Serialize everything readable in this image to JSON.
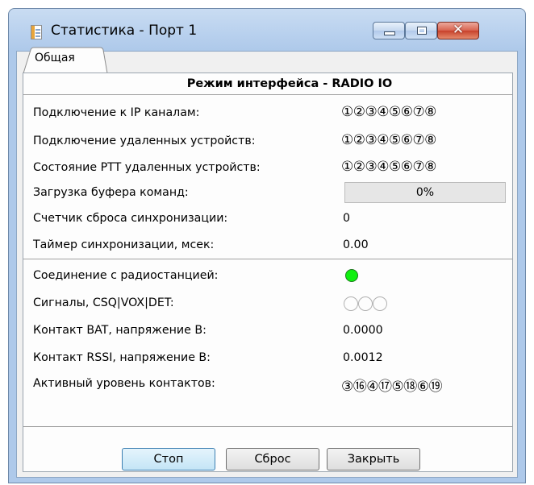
{
  "window": {
    "title": "Статистика - Порт 1",
    "controls": {
      "minimize_icon": "minimize-icon",
      "maximize_icon": "maximize-icon",
      "close_glyph": "✕"
    }
  },
  "tabs": [
    {
      "label": "Общая",
      "active": true
    }
  ],
  "section_header": "Режим интерфейса - RADIO IO",
  "rows": [
    {
      "label": "Подключение к IP каналам:",
      "value": "①②③④⑤⑥⑦⑧"
    },
    {
      "label": "Подключение удаленных устройств:",
      "value": "①②③④⑤⑥⑦⑧"
    },
    {
      "label": "Состояние PTT удаленных устройств:",
      "value": "①②③④⑤⑥⑦⑧"
    },
    {
      "label": "Загрузка буфера команд:",
      "value": "0%",
      "progress": 0
    },
    {
      "label": "Счетчик сброса синхронизации:",
      "value": "0"
    },
    {
      "label": "Таймер синхронизации, мсек:",
      "value": "0.00"
    },
    {
      "label": "Соединение с радиостанцией:",
      "status_color": "#10f010"
    },
    {
      "label": "Сигналы, CSQ|VOX|DET:",
      "signals": [
        "off",
        "off",
        "off"
      ]
    },
    {
      "label": "Контакт BAT, напряжение В:",
      "value": "0.0000"
    },
    {
      "label": "Контакт RSSI, напряжение В:",
      "value": "0.0012"
    },
    {
      "label": "Активный уровень контактов:",
      "value": "③⑯④⑰⑤⑱⑥⑲"
    }
  ],
  "buttons": {
    "stop": "Стоп",
    "reset": "Сброс",
    "close": "Закрыть"
  }
}
